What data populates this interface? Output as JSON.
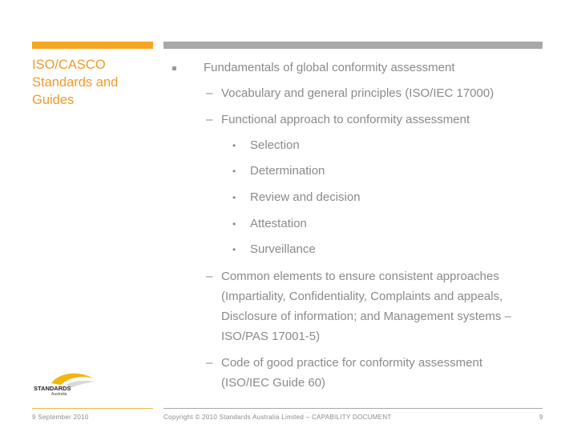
{
  "sidebar": {
    "title": "ISO/CASCO Standards and Guides",
    "accent_color": "#f6a623"
  },
  "main": {
    "heading_bullet": "Fundamentals of global conformity assessment",
    "items": [
      {
        "text": "Vocabulary and general principles (ISO/IEC 17000)"
      },
      {
        "text": "Functional approach to conformity assessment",
        "subitems": [
          "Selection",
          "Determination",
          "Review and decision",
          "Attestation",
          "Surveillance"
        ]
      },
      {
        "text": "Common elements to ensure consistent approaches (Impartiality, Confidentiality, Complaints and appeals, Disclosure of information; and Management systems – ISO/PAS 17001-5)"
      },
      {
        "text": "Code of good practice for conformity assessment (ISO/IEC Guide 60)"
      }
    ],
    "dash_glyph": "–",
    "dot_glyph": "•"
  },
  "logo": {
    "name": "STANDARDS",
    "subname": "Australia"
  },
  "footer": {
    "date": "9 September 2010",
    "copyright": "Copyright © 2010 Standards Australia Limited  – CAPABILITY DOCUMENT",
    "page_number": "9"
  }
}
